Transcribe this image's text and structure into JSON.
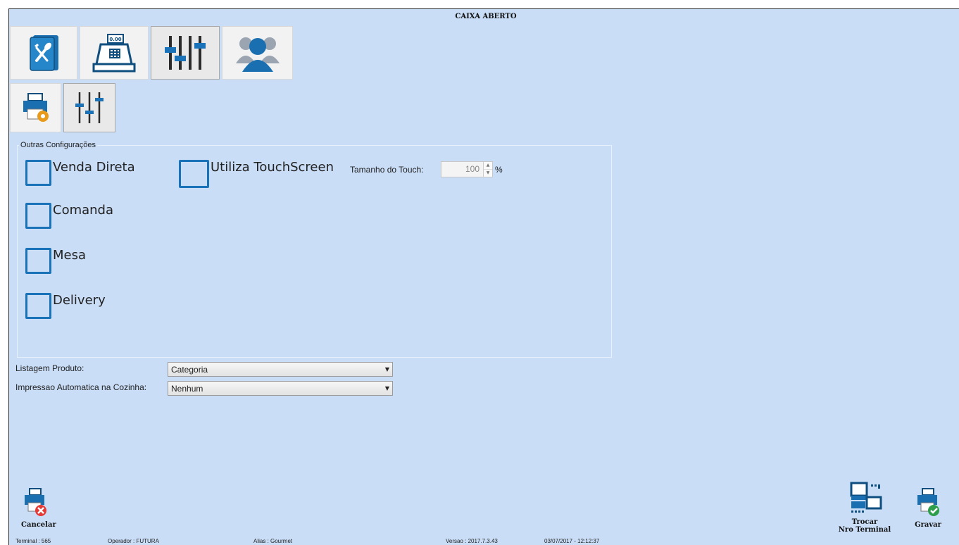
{
  "window": {
    "title": "CAIXA ABERTO"
  },
  "top_tabs": [
    {
      "icon": "menu-book-icon",
      "selected": false
    },
    {
      "icon": "cash-register-icon",
      "selected": false,
      "display": "0.00"
    },
    {
      "icon": "sliders-icon",
      "selected": true
    },
    {
      "icon": "users-icon",
      "selected": false
    }
  ],
  "sub_tabs": [
    {
      "icon": "printer-settings-icon",
      "selected": false
    },
    {
      "icon": "sliders-icon",
      "selected": true
    }
  ],
  "group": {
    "legend": "Outras Configurações",
    "options": [
      {
        "label": "Venda Direta",
        "checked": false
      },
      {
        "label": "Comanda",
        "checked": false
      },
      {
        "label": "Mesa",
        "checked": false
      },
      {
        "label": "Delivery",
        "checked": false
      },
      {
        "label": "Utiliza TouchScreen",
        "checked": false
      }
    ],
    "touch_size": {
      "label": "Tamanho do Touch:",
      "value": "100",
      "unit": "%"
    }
  },
  "fields": {
    "listagem": {
      "label": "Listagem Produto:",
      "value": "Categoria"
    },
    "impressao": {
      "label": "Impressao Automatica na Cozinha:",
      "value": "Nenhum"
    }
  },
  "actions": {
    "cancel": "Cancelar",
    "change_terminal_line1": "Trocar",
    "change_terminal_line2": "Nro Terminal",
    "save": "Gravar"
  },
  "status_bar": {
    "terminal": "Terminal : 565",
    "operator": "Operador : FUTURA",
    "alias": "Alias : Gourmet",
    "version": "Versao : 2017.7.3.43",
    "datetime": "03/07/2017 - 12:12:37"
  },
  "colors": {
    "background": "#c9ddf7",
    "checkbox_border": "#1a73b8",
    "icon_blue": "#1a73b8"
  }
}
